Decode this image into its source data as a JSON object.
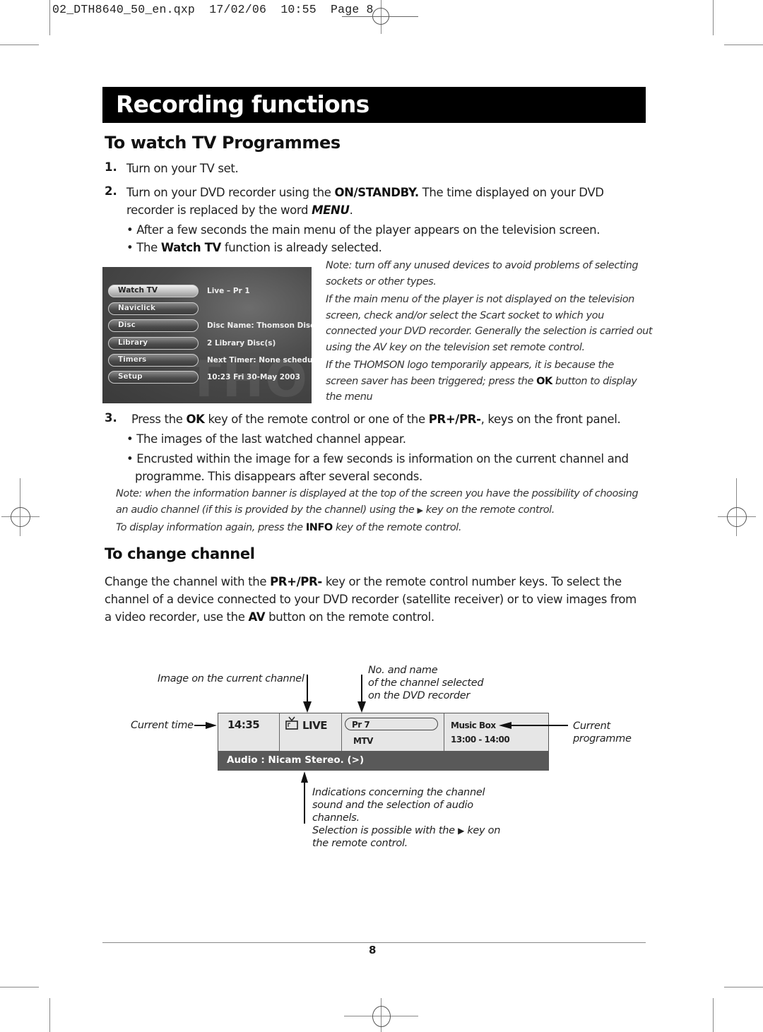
{
  "slug": {
    "filename": "02_DTH8640_50_en.qxp",
    "date": "17/02/06",
    "time": "10:55",
    "page_label": "Page 8"
  },
  "header": {
    "title": "Recording functions"
  },
  "section1": {
    "heading": "To watch TV Programmes",
    "step1": {
      "num": "1.",
      "text": "Turn on your TV set."
    },
    "step2": {
      "num": "2.",
      "pre": "Turn on your DVD recorder using the ",
      "key": "ON/STANDBY.",
      "mid": " The time displayed on your DVD",
      "line2_pre": "recorder is replaced by the word ",
      "line2_key": "MENU",
      "line2_post": ".",
      "bullet1": "• After a few seconds the main menu of the player appears on the television screen.",
      "bullet2_pre": "• The ",
      "bullet2_key": "Watch TV",
      "bullet2_post": " function is already selected."
    },
    "menu_screenshot": {
      "items": [
        {
          "label": "Watch TV",
          "value": "Live – Pr 1",
          "selected": true
        },
        {
          "label": "Naviclick",
          "value": "",
          "selected": false
        },
        {
          "label": "Disc",
          "value": "Disc Name: Thomson Disc",
          "selected": false
        },
        {
          "label": "Library",
          "value": "2 Library Disc(s)",
          "selected": false
        },
        {
          "label": "Timers",
          "value": "Next Timer: None schedul",
          "selected": false
        },
        {
          "label": "Setup",
          "value": "10:23 Fri 30-May 2003",
          "selected": false
        }
      ],
      "watermark": "THOMSON"
    },
    "side_notes": {
      "n1_l1": "Note: turn off any unused devices to avoid problems of selecting",
      "n1_l2": "sockets or other types.",
      "n2_l1": "If the main menu of the player is not displayed on the television",
      "n2_l2": "screen, check and/or select the Scart socket to which you",
      "n2_l3": "connected your DVD recorder. Generally the selection is carried out",
      "n2_l4": "using the AV key on the television set remote control.",
      "n3_l1": "If the THOMSON logo temporarily appears, it is because the",
      "n3_l2_pre": "screen saver has been triggered; press the ",
      "n3_l2_key": "OK",
      "n3_l2_post": " button to display",
      "n3_l3": "the menu"
    },
    "step3": {
      "num": "3.",
      "pre": "Press the ",
      "key1": "OK",
      "mid": " key of the remote control or one of the ",
      "key2": "PR+/PR-",
      "post": ", keys on the front panel.",
      "bullet1": "• The images of the last watched channel appear.",
      "bullet2_l1": "• Encrusted within the image for a few seconds is information on the current channel and",
      "bullet2_l2": "programme. This disappears after several seconds."
    },
    "notes": {
      "n1_l1": "Note: when the information banner is displayed at the top of the screen you have the possibility of choosing",
      "n1_l2_pre": "an audio channel (if this is provided by the channel) using the ",
      "n1_l2_icon": "▶",
      "n1_l2_post": " key on the remote control.",
      "n2_pre": "To display information again, press the ",
      "n2_key": "INFO",
      "n2_post": " key of the remote control."
    }
  },
  "section2": {
    "heading": "To change channel",
    "p_l1_pre": "Change the channel with the ",
    "p_l1_key": "PR+/PR-",
    "p_l1_post": " key or the remote control number keys. To select the",
    "p_l2": "channel of a device connected to your DVD recorder (satellite receiver) or to view images from",
    "p_l3_pre": "a video recorder, use the ",
    "p_l3_key": "AV",
    "p_l3_post": " button on the remote control."
  },
  "diagram": {
    "banner": {
      "time": "14:35",
      "live_label": "LIVE",
      "channel_no": "Pr 7",
      "channel_name": "MTV",
      "programme": "Music Box",
      "programme_time": "13:00 - 14:00",
      "audio": "Audio : Nicam Stereo. (>)"
    },
    "captions": {
      "image": "Image on the current channel",
      "no_name_l1": "No. and name",
      "no_name_l2": "of the channel selected",
      "no_name_l3": "on the DVD recorder",
      "current_time": "Current time",
      "current_prog_l1": "Current",
      "current_prog_l2": "programme",
      "indications_l1": "Indications concerning the channel",
      "indications_l2": "sound and the selection of audio",
      "indications_l3": "channels.",
      "indications_l4_pre": "Selection is possible with the ",
      "indications_l4_icon": "▶",
      "indications_l4_post": " key on",
      "indications_l5": "the remote control."
    }
  },
  "footer": {
    "page_number": "8"
  }
}
